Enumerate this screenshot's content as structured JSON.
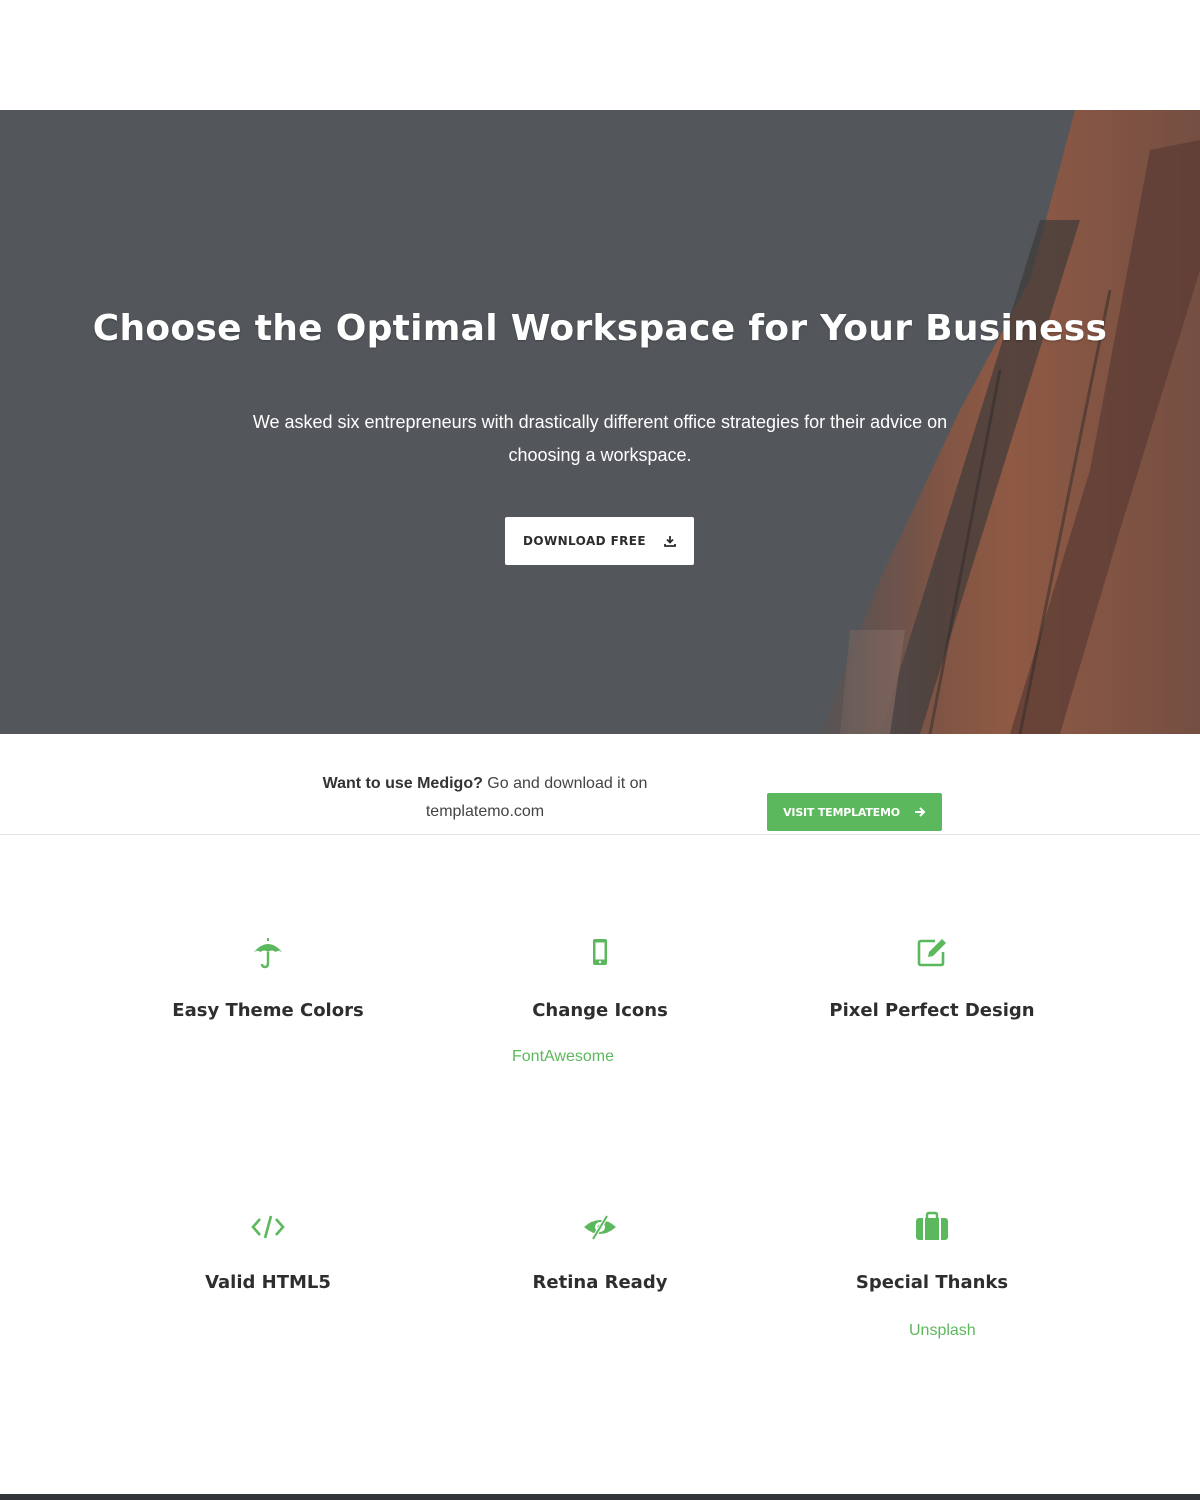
{
  "hero": {
    "title": "Choose the Optimal Workspace for Your Business",
    "subtitle_line1": "We asked six entrepreneurs with drastically different office strategies for their advice on",
    "subtitle_line2": "choosing a workspace.",
    "download_button": {
      "label": "DOWNLOAD FREE",
      "icon": "download-icon"
    }
  },
  "cta": {
    "bold": "Want to use Medigo?",
    "text_line1": " Go and download it on",
    "text_line2": "templatemo.com",
    "button": {
      "label": "VISIT TEMPLATEMO",
      "icon": "arrow-right-icon"
    }
  },
  "features": [
    {
      "title": "Easy Theme Colors",
      "icon": "umbrella-icon",
      "link": ""
    },
    {
      "title": "Change Icons",
      "icon": "mobile-icon",
      "link": "FontAwesome"
    },
    {
      "title": "Pixel Perfect Design",
      "icon": "edit-icon",
      "link": ""
    },
    {
      "title": "Valid HTML5",
      "icon": "code-icon",
      "link": ""
    },
    {
      "title": "Retina Ready",
      "icon": "eye-slash-icon",
      "link": ""
    },
    {
      "title": "Special Thanks",
      "icon": "briefcase-icon",
      "link": "Unsplash"
    }
  ],
  "colors": {
    "accent": "#5cb85c",
    "hero_overlay": "#53575b",
    "heading": "#2e2e2e",
    "footer": "#303538"
  }
}
